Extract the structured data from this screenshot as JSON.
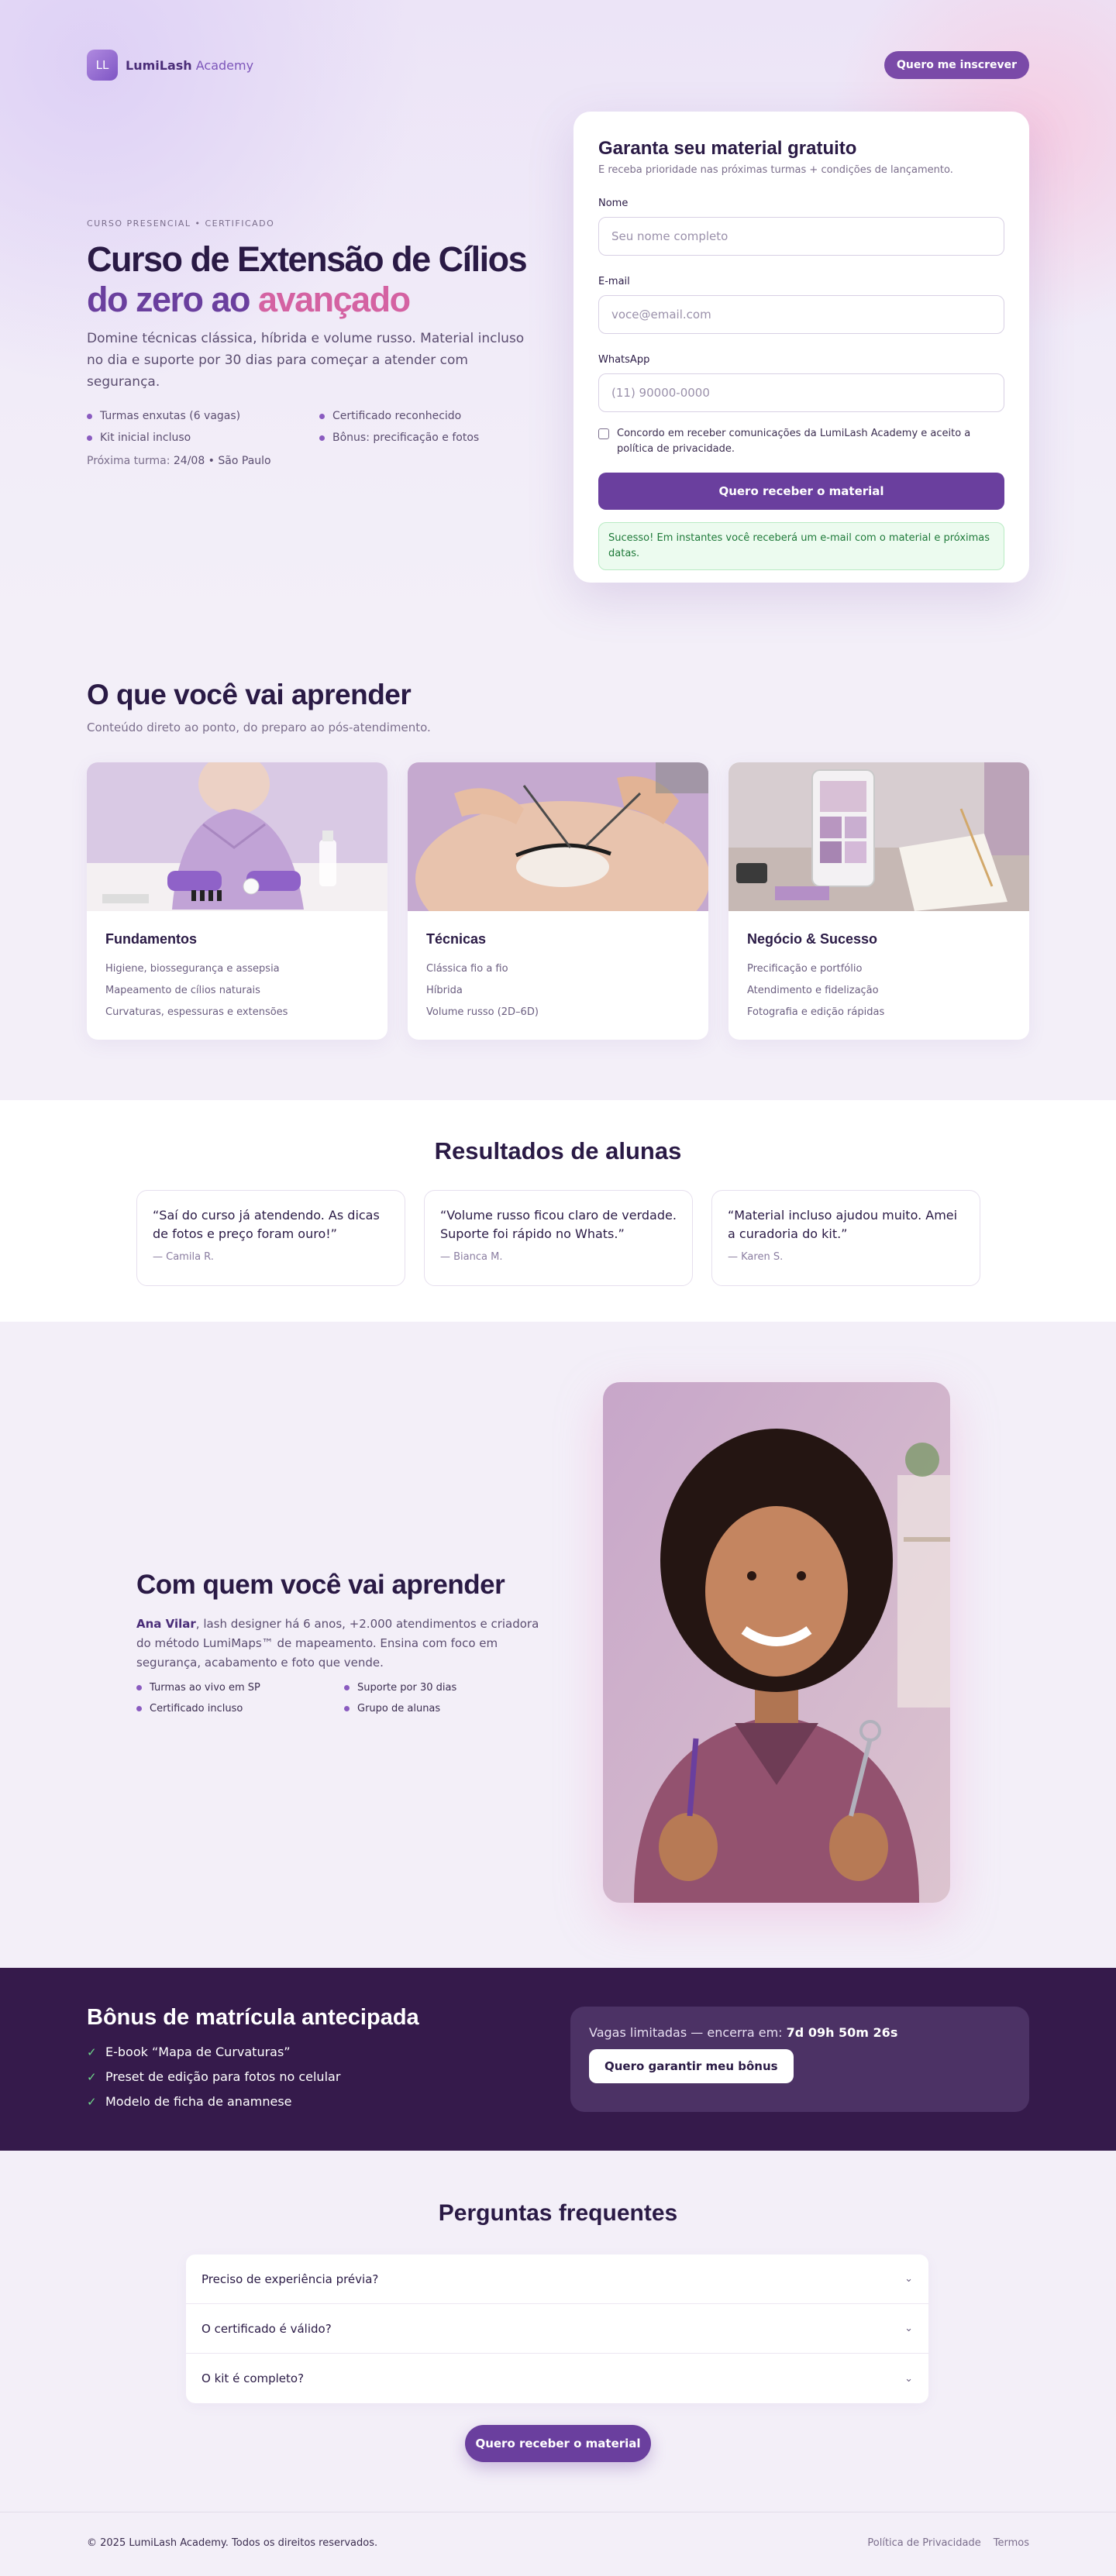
{
  "brand": {
    "logo_initials": "LL",
    "name_bold": "LumiLash",
    "name_rest": " Academy"
  },
  "nav": {
    "cta_label": "Quero me inscrever"
  },
  "hero": {
    "eyebrow": "CURSO PRESENCIAL • CERTIFICADO",
    "title_line1": "Curso de Extensão de Cílios",
    "title_line2_start": "do zero ao ",
    "title_line2_accent": "avançado",
    "description": "Domine técnicas clássica, híbrida e volume russo. Material incluso no dia e suporte por 30 dias para começar a atender com segurança.",
    "features": [
      "Turmas enxutas (6 vagas)",
      "Certificado reconhecido",
      "Kit inicial incluso",
      "Bônus: precificação e fotos"
    ],
    "next_class_label": "Próxima turma: ",
    "next_class_value": "24/08 • São Paulo"
  },
  "form": {
    "title": "Garanta seu material gratuito",
    "subtitle": "E receba prioridade nas próximas turmas + condições de lançamento.",
    "name_label": "Nome",
    "name_placeholder": "Seu nome completo",
    "email_label": "E-mail",
    "email_placeholder": "voce@email.com",
    "whatsapp_label": "WhatsApp",
    "whatsapp_placeholder": "(11) 90000-0000",
    "consent_text": "Concordo em receber comunicações da LumiLash Academy e aceito a política de privacidade.",
    "submit_label": "Quero receber o material",
    "success_message": "Sucesso! Em instantes você receberá um e-mail com o material e próximas datas."
  },
  "learn": {
    "title": "O que você vai aprender",
    "subtitle": "Conteúdo direto ao ponto, do preparo ao pós-atendimento.",
    "cards": [
      {
        "title": "Fundamentos",
        "items": [
          "Higiene, biossegurança e assepsia",
          "Mapeamento de cílios naturais",
          "Curvaturas, espessuras e extensões"
        ]
      },
      {
        "title": "Técnicas",
        "items": [
          "Clássica fio a fio",
          "Híbrida",
          "Volume russo (2D–6D)"
        ]
      },
      {
        "title": "Negócio & Sucesso",
        "items": [
          "Precificação e portfólio",
          "Atendimento e fidelização",
          "Fotografia e edição rápidas"
        ]
      }
    ]
  },
  "results": {
    "title": "Resultados de alunas",
    "testimonials": [
      {
        "quote": "“Saí do curso já atendendo. As dicas de fotos e preço foram ouro!”",
        "author": "— Camila R."
      },
      {
        "quote": "“Volume russo ficou claro de verdade. Suporte foi rápido no Whats.”",
        "author": "— Bianca M."
      },
      {
        "quote": "“Material incluso ajudou muito. Amei a curadoria do kit.”",
        "author": "— Karen S."
      }
    ]
  },
  "instructor": {
    "title": "Com quem você vai aprender",
    "name": "Ana Vilar",
    "bio": ", lash designer há 6 anos, +2.000 atendimentos e criadora do método LumiMaps™ de mapeamento. Ensina com foco em segurança, acabamento e foto que vende.",
    "features": [
      "Turmas ao vivo em SP",
      "Suporte por 30 dias",
      "Certificado incluso",
      "Grupo de alunas"
    ]
  },
  "bonus": {
    "title": "Bônus de matrícula antecipada",
    "items": [
      "E-book “Mapa de Curvaturas”",
      "Preset de edição para fotos no celular",
      "Modelo de ficha de anamnese"
    ],
    "countdown_label": "Vagas limitadas — encerra em: ",
    "countdown_value": "7d 09h 50m 26s",
    "cta_label": "Quero garantir meu bônus"
  },
  "faq": {
    "title": "Perguntas frequentes",
    "items": [
      "Preciso de experiência prévia?",
      "O certificado é válido?",
      "O kit é completo?"
    ],
    "cta_label": "Quero receber o material"
  },
  "footer": {
    "copyright": "© 2025 LumiLash Academy. Todos os direitos reservados.",
    "links": [
      "Política de Privacidade",
      "Termos"
    ]
  },
  "colors": {
    "primary": "#6a3f9e",
    "accent": "#d462a2",
    "dark": "#351a4b",
    "success": "#1f7a3a"
  },
  "icons": {
    "check": "check-icon",
    "chevron": "chevron-down-icon",
    "bullet": "bullet-dot"
  }
}
